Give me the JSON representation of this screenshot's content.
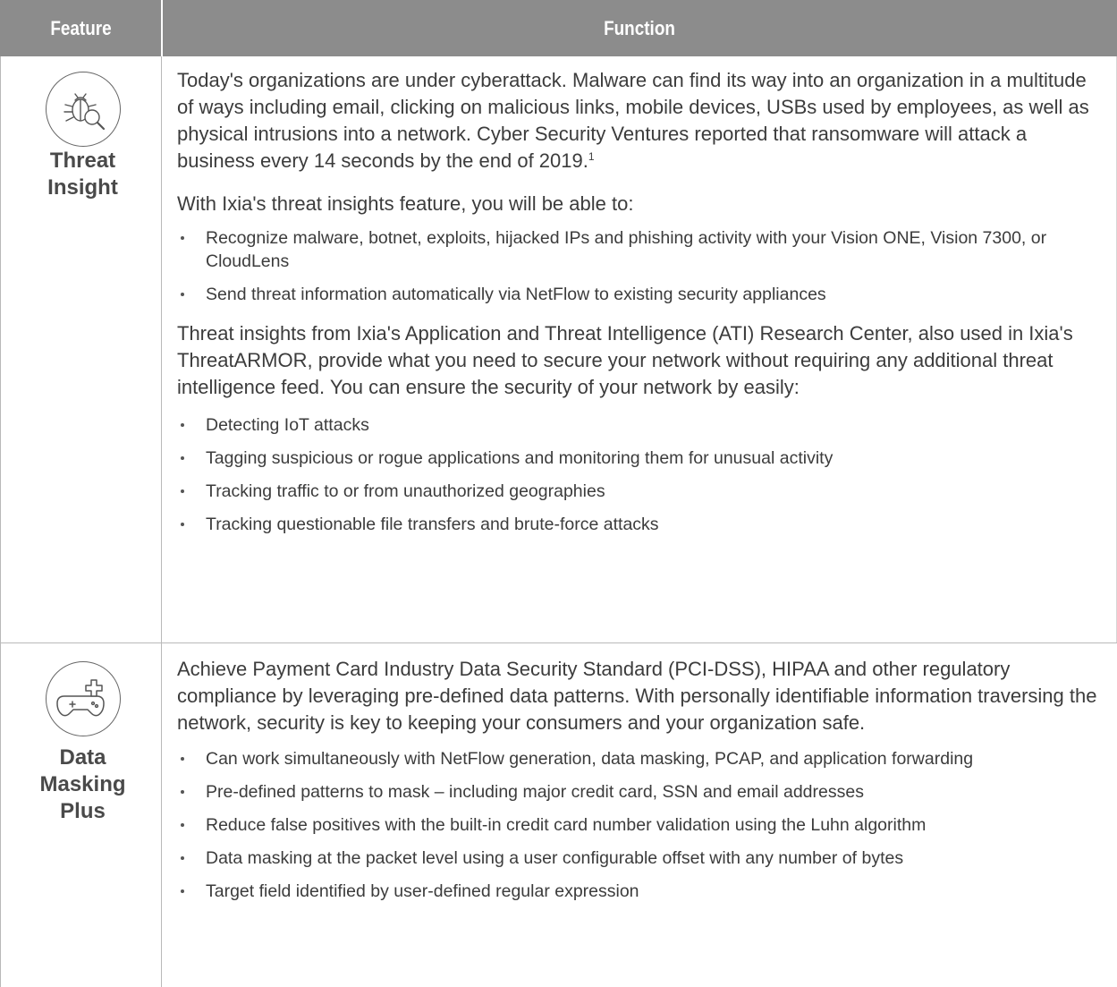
{
  "header": {
    "feature": "Feature",
    "function": "Function"
  },
  "rows": [
    {
      "icon": "bug-magnifier-icon",
      "feature": "Threat\nInsight",
      "paragraph1": "Today's organizations are under cyberattack. Malware can find its way into an organization in a multitude of ways including email, clicking on malicious links, mobile devices, USBs used by employees, as well as physical intrusions into a network. Cyber Security Ventures reported that ransomware will attack a business every 14 seconds by the end of 2019.",
      "footnote": "1",
      "paragraph2": "With Ixia's threat insights feature, you will be able to:",
      "bullets1": [
        "Recognize malware, botnet, exploits, hijacked IPs and phishing activity with your Vision ONE, Vision 7300, or CloudLens",
        "Send threat information automatically via NetFlow to existing security appliances"
      ],
      "paragraph3": "Threat insights from Ixia's Application and Threat Intelligence (ATI) Research Center, also used in Ixia's ThreatARMOR, provide what you need to secure your network without requiring any additional threat intelligence feed. You can ensure the security of your network by easily:",
      "bullets2": [
        "Detecting IoT attacks",
        "Tagging suspicious or rogue applications and monitoring them for unusual activity",
        "Tracking traffic to or from unauthorized geographies",
        "Tracking questionable file transfers and brute-force attacks"
      ]
    },
    {
      "icon": "game-controller-plus-icon",
      "feature": "Data\nMasking\nPlus",
      "paragraph1": "Achieve Payment Card Industry Data Security Standard (PCI-DSS), HIPAA and other regulatory compliance by leveraging pre-defined data patterns. With personally identifiable information traversing the network, security is key to keeping your consumers and your organization safe.",
      "bullets1": [
        "Can work simultaneously with NetFlow generation, data masking, PCAP, and application forwarding",
        "Pre-defined patterns to mask – including major credit card, SSN and email addresses",
        "Reduce false positives with the built-in credit card number validation using the Luhn algorithm",
        "Data masking at the packet level using a user configurable offset with any number of bytes",
        "Target field identified by user-defined regular expression"
      ]
    }
  ]
}
